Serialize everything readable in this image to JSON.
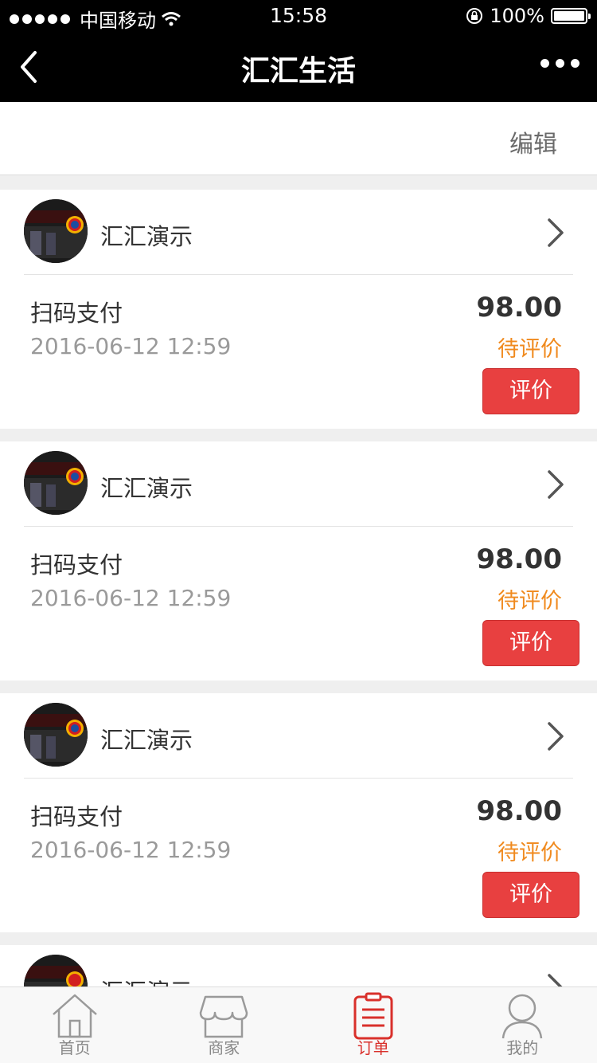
{
  "status_bar": {
    "carrier": "中国移动",
    "time": "15:58",
    "battery": "100%"
  },
  "nav": {
    "title": "汇汇生活"
  },
  "toolbar": {
    "edit_label": "编辑"
  },
  "orders": [
    {
      "shop_name": "汇汇演示",
      "pay_type": "扫码支付",
      "time": "2016-06-12 12:59",
      "amount": "98.00",
      "status": "待评价",
      "action": "评价"
    },
    {
      "shop_name": "汇汇演示",
      "pay_type": "扫码支付",
      "time": "2016-06-12 12:59",
      "amount": "98.00",
      "status": "待评价",
      "action": "评价"
    },
    {
      "shop_name": "汇汇演示",
      "pay_type": "扫码支付",
      "time": "2016-06-12 12:59",
      "amount": "98.00",
      "status": "待评价",
      "action": "评价"
    },
    {
      "shop_name": "汇汇演示"
    }
  ],
  "tabs": [
    {
      "label": "首页",
      "icon": "home-icon",
      "active": false
    },
    {
      "label": "商家",
      "icon": "store-icon",
      "active": false
    },
    {
      "label": "订单",
      "icon": "order-clipboard-icon",
      "active": true
    },
    {
      "label": "我的",
      "icon": "user-icon",
      "active": false
    }
  ],
  "colors": {
    "accent": "#d9302b",
    "button_red": "#e84040",
    "status_orange": "#f08a1e",
    "nav_bg": "#000000"
  }
}
